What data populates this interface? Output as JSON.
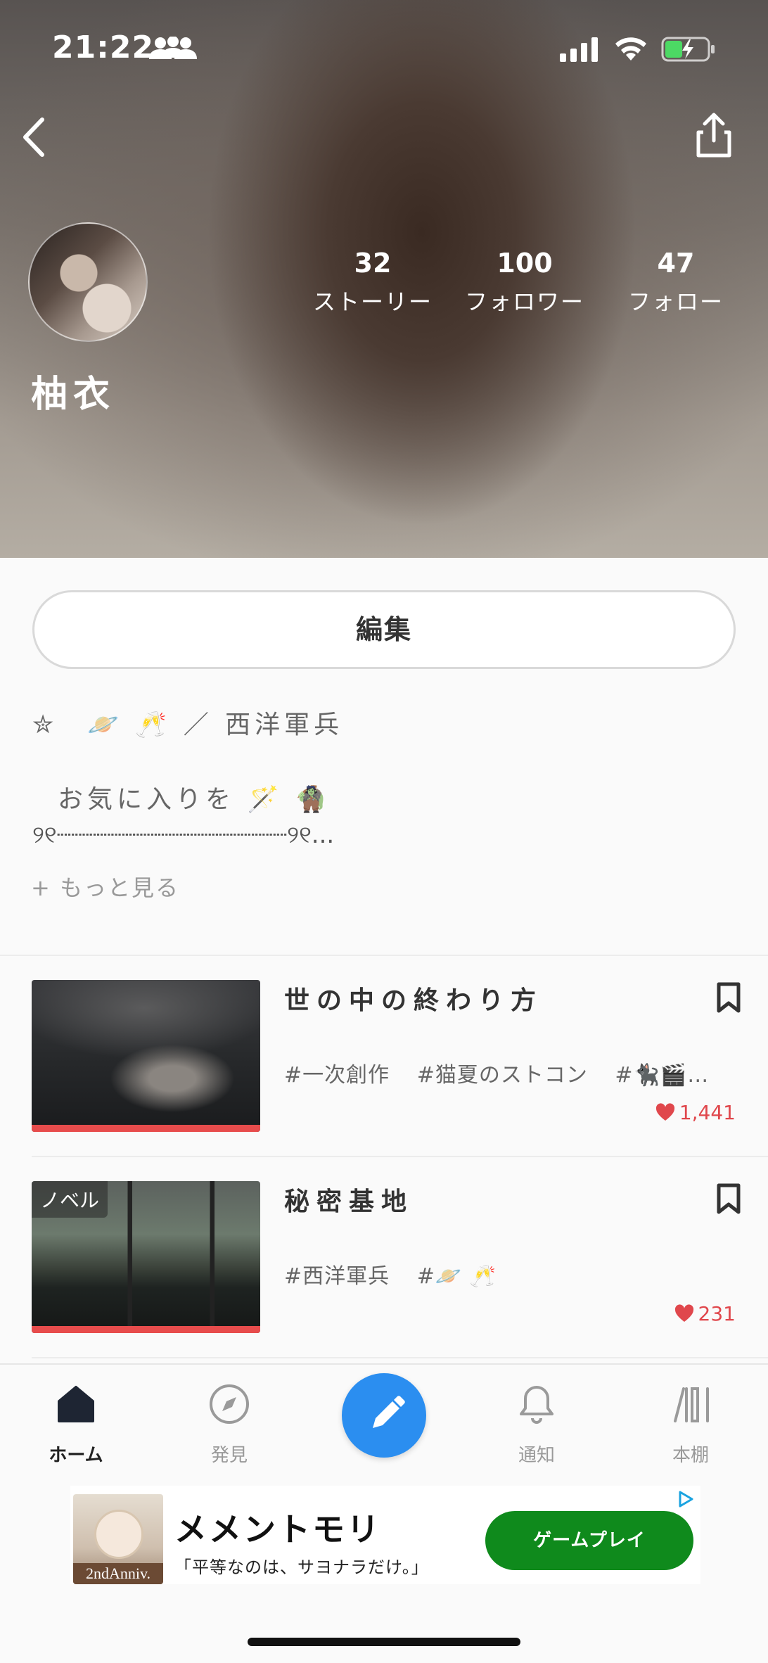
{
  "status_bar": {
    "time": "21:22"
  },
  "profile": {
    "username": "柚衣",
    "stats": [
      {
        "count": "32",
        "label": "ストーリー"
      },
      {
        "count": "100",
        "label": "フォロワー"
      },
      {
        "count": "47",
        "label": "フォロー"
      }
    ],
    "edit_label": "編集",
    "bio": {
      "line1": "✮　🪐 🥂 ／ 西洋軍兵",
      "line2": "お気に入りを 🪄 🧌",
      "line3": "୨୧┈┈┈┈┈┈┈┈┈┈┈┈┈┈┈┈୨୧..."
    },
    "more_label": "+ もっと見る"
  },
  "stories": [
    {
      "title": "世の中の終わり方",
      "badge": "",
      "tags": [
        "#一次創作",
        "#猫夏のストコン",
        "#🐈‍⬛🎬ス…"
      ],
      "likes": "1,441"
    },
    {
      "title": "秘密基地",
      "badge": "ノベル",
      "tags": [
        "#西洋軍兵",
        "#🪐 🥂"
      ],
      "likes": "231"
    }
  ],
  "tabbar": {
    "home": "ホーム",
    "discover": "発見",
    "notify": "通知",
    "shelf": "本棚"
  },
  "ad": {
    "title": "メメントモリ",
    "subtitle": "「平等なのは、サヨナラだけ。」",
    "button": "ゲームプレイ",
    "image_caption": "2ndAnniv."
  },
  "colors": {
    "accent_blue": "#2b8ef0",
    "like_red": "#e0474c",
    "progress_red": "#e74c4c",
    "ad_green": "#0f8a1c"
  }
}
